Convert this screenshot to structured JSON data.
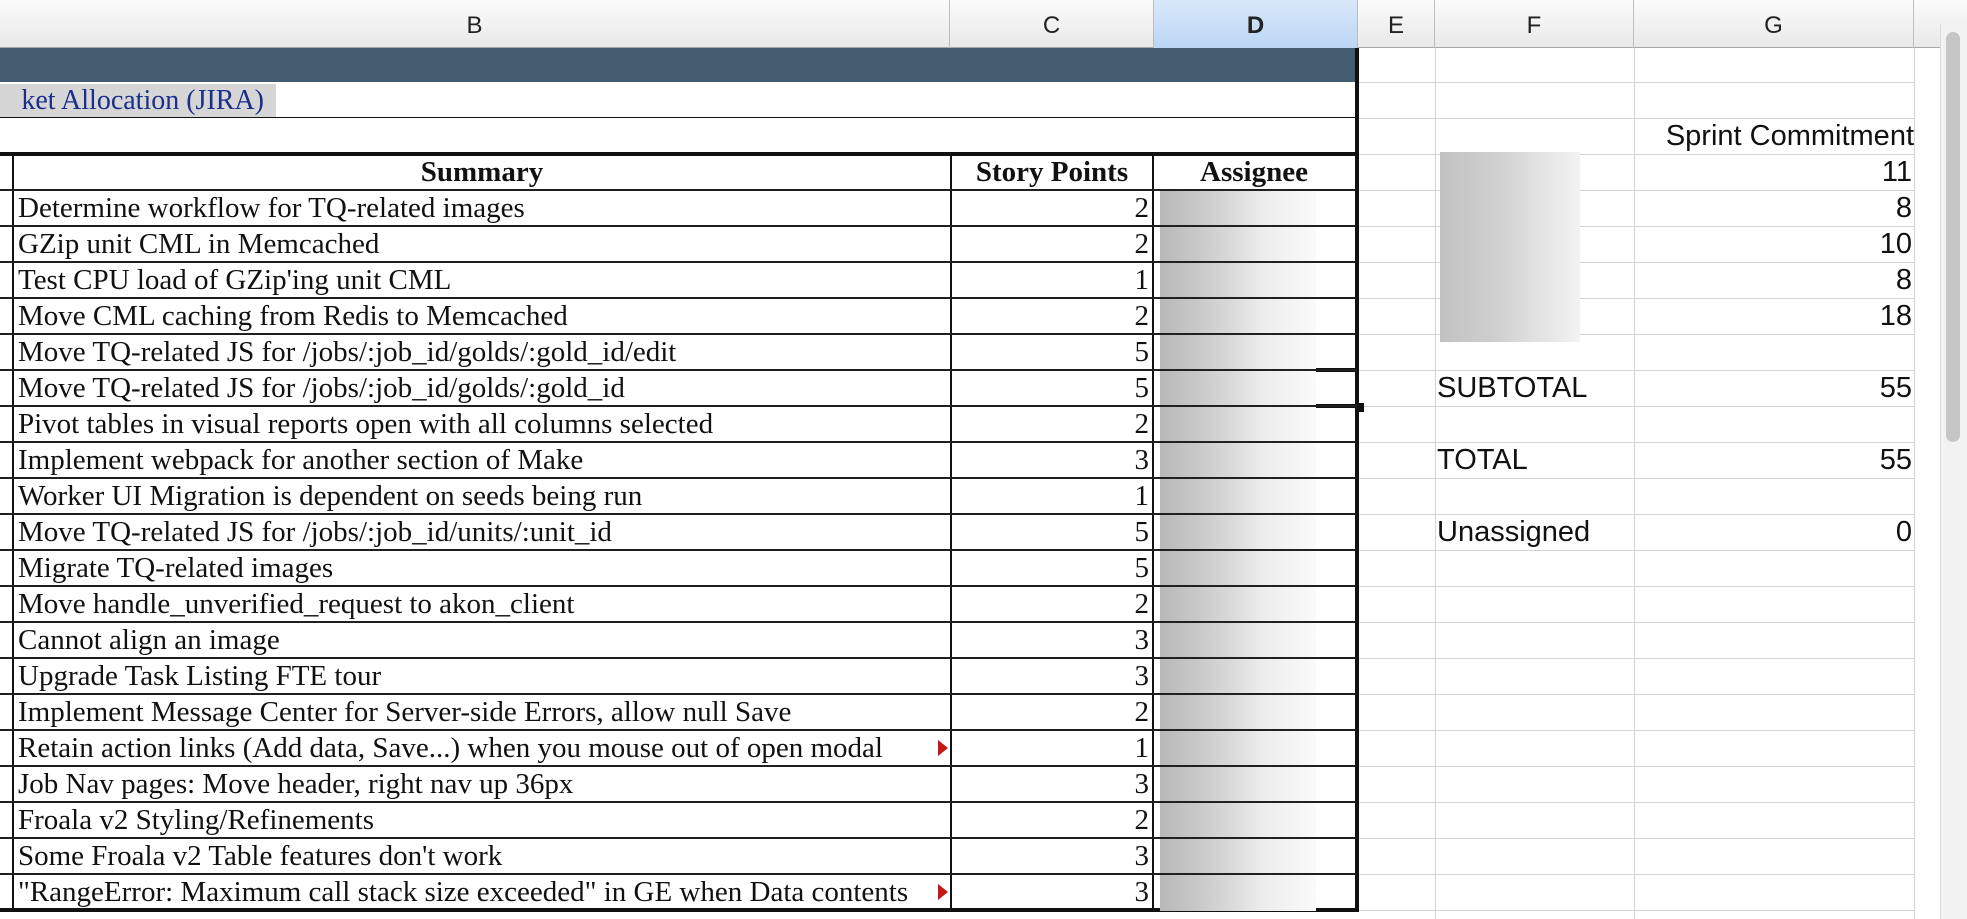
{
  "columns": [
    "B",
    "C",
    "D",
    "E",
    "F",
    "G"
  ],
  "selected_column": "D",
  "sheet": {
    "link_text": "ket Allocation (JIRA)",
    "headers": {
      "summary": "Summary",
      "story_points": "Story Points",
      "assignee": "Assignee"
    },
    "rows": [
      {
        "summary": "Determine workflow for TQ-related images",
        "points": "2"
      },
      {
        "summary": "GZip unit CML in Memcached",
        "points": "2"
      },
      {
        "summary": "Test CPU load of GZip'ing unit CML",
        "points": "1"
      },
      {
        "summary": "Move CML caching from Redis to Memcached",
        "points": "2"
      },
      {
        "summary": "Move TQ-related JS for /jobs/:job_id/golds/:gold_id/edit",
        "points": "5"
      },
      {
        "summary": "Move TQ-related JS for /jobs/:job_id/golds/:gold_id",
        "points": "5"
      },
      {
        "summary": "Pivot tables in visual reports open with all columns selected",
        "points": "2"
      },
      {
        "summary": "Implement webpack for another section of Make",
        "points": "3"
      },
      {
        "summary": "Worker UI Migration is dependent on seeds being run",
        "points": "1"
      },
      {
        "summary": "Move TQ-related JS for /jobs/:job_id/units/:unit_id",
        "points": "5"
      },
      {
        "summary": "Migrate TQ-related images",
        "points": "5"
      },
      {
        "summary": "Move handle_unverified_request to akon_client",
        "points": "2"
      },
      {
        "summary": "Cannot align an image",
        "points": "3"
      },
      {
        "summary": "Upgrade Task Listing FTE tour",
        "points": "3"
      },
      {
        "summary": "Implement Message Center for Server-side Errors, allow null Save",
        "points": "2"
      },
      {
        "summary": "Retain action links (Add data, Save...) when you mouse out of open modal",
        "points": "1"
      },
      {
        "summary": "Job Nav pages: Move header, right nav up 36px",
        "points": "3"
      },
      {
        "summary": "Froala v2 Styling/Refinements",
        "points": "2"
      },
      {
        "summary": "Some Froala v2 Table features don't work",
        "points": "3"
      },
      {
        "summary": "\"RangeError: Maximum call stack size exceeded\" in GE when Data contents",
        "points": "3"
      }
    ]
  },
  "summary_panel": {
    "sprint_header": "Sprint Commitment",
    "commitments": [
      "11",
      "8",
      "10",
      "8",
      "18"
    ],
    "subtotal_label": "SUBTOTAL",
    "subtotal_value": "55",
    "total_label": "TOTAL",
    "total_value": "55",
    "unassigned_label": "Unassigned",
    "unassigned_value": "0"
  },
  "colors": {
    "banner": "#435c70",
    "link_text": "#1b2f8a",
    "selected_column": "#bcd6f4",
    "overflow_marker": "#c21818"
  }
}
